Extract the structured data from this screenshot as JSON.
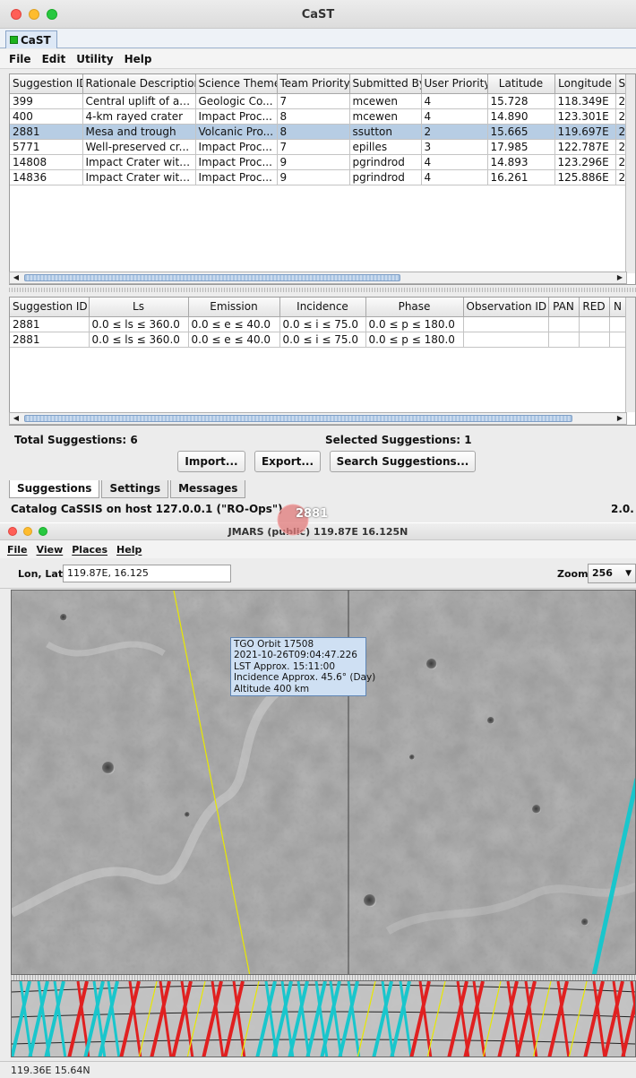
{
  "cast": {
    "title": "CaST",
    "tab_label": "CaST",
    "menu": [
      "File",
      "Edit",
      "Utility",
      "Help"
    ],
    "suggestions_table": {
      "columns": [
        "Suggestion ID",
        "Rationale Description",
        "Science Theme",
        "Team Priority",
        "Submitted By",
        "User Priority",
        "Latitude",
        "Longitude",
        "S"
      ],
      "rows": [
        [
          "399",
          "Central uplift of an...",
          "Geologic Co...",
          "7",
          "mcewen",
          "4",
          "15.728",
          "118.349E",
          "2"
        ],
        [
          "400",
          "4-km rayed crater",
          "Impact Proc...",
          "8",
          "mcewen",
          "4",
          "14.890",
          "123.301E",
          "2"
        ],
        [
          "2881",
          "Mesa and trough",
          "Volcanic Pro...",
          "8",
          "ssutton",
          "2",
          "15.665",
          "119.697E",
          "2"
        ],
        [
          "5771",
          "Well-preserved cr...",
          "Impact Proc...",
          "7",
          "epilles",
          "3",
          "17.985",
          "122.787E",
          "2"
        ],
        [
          "14808",
          "Impact Crater with ...",
          "Impact Proc...",
          "9",
          "pgrindrod",
          "4",
          "14.893",
          "123.296E",
          "2"
        ],
        [
          "14836",
          "Impact Crater with ...",
          "Impact Proc...",
          "9",
          "pgrindrod",
          "4",
          "16.261",
          "125.886E",
          "2"
        ]
      ],
      "selected_row": 2
    },
    "observations_table": {
      "columns": [
        "Suggestion ID",
        "Ls",
        "Emission",
        "Incidence",
        "Phase",
        "Observation ID",
        "PAN",
        "RED",
        "N"
      ],
      "rows": [
        [
          "2881",
          "0.0 ≤ ls ≤ 360.0",
          "0.0 ≤ e ≤ 40.0",
          "0.0 ≤ i ≤ 75.0",
          "0.0 ≤ p ≤ 180.0",
          "",
          "",
          "",
          ""
        ],
        [
          "2881",
          "0.0 ≤ ls ≤ 360.0",
          "0.0 ≤ e ≤ 40.0",
          "0.0 ≤ i ≤ 75.0",
          "0.0 ≤ p ≤ 180.0",
          "",
          "",
          "",
          ""
        ]
      ]
    },
    "total_suggestions": "Total Suggestions: 6",
    "selected_suggestions": "Selected Suggestions: 1",
    "buttons": {
      "import": "Import...",
      "export": "Export...",
      "search": "Search Suggestions..."
    },
    "bottom_tabs": [
      "Suggestions",
      "Settings",
      "Messages"
    ],
    "status": "Catalog CaSSIS on host 127.0.0.1 (\"RO-Ops\")",
    "version": "2.0."
  },
  "jmars": {
    "title": "JMARS (public) 119.87E 16.125N",
    "menu": [
      "File",
      "View",
      "Places",
      "Help"
    ],
    "lonlat_label": "Lon, Lat:",
    "lonlat_value": "119.87E, 16.125",
    "zoom_label": "Zoom:",
    "zoom_value": "256",
    "target_label": "2881",
    "tooltip": [
      "TGO Orbit 17508",
      "2021-10-26T09:04:47.226",
      "LST Approx. 15:11:00",
      "Incidence Approx. 45.6° (Day)",
      "Altitude 400 km"
    ],
    "cursor_coords": "119.36E   15.64N",
    "colors": {
      "orbit_track": "#e8e800",
      "footprint": "#19c6cc",
      "target": "#e07a7a",
      "panner_red": "#e02020"
    }
  }
}
